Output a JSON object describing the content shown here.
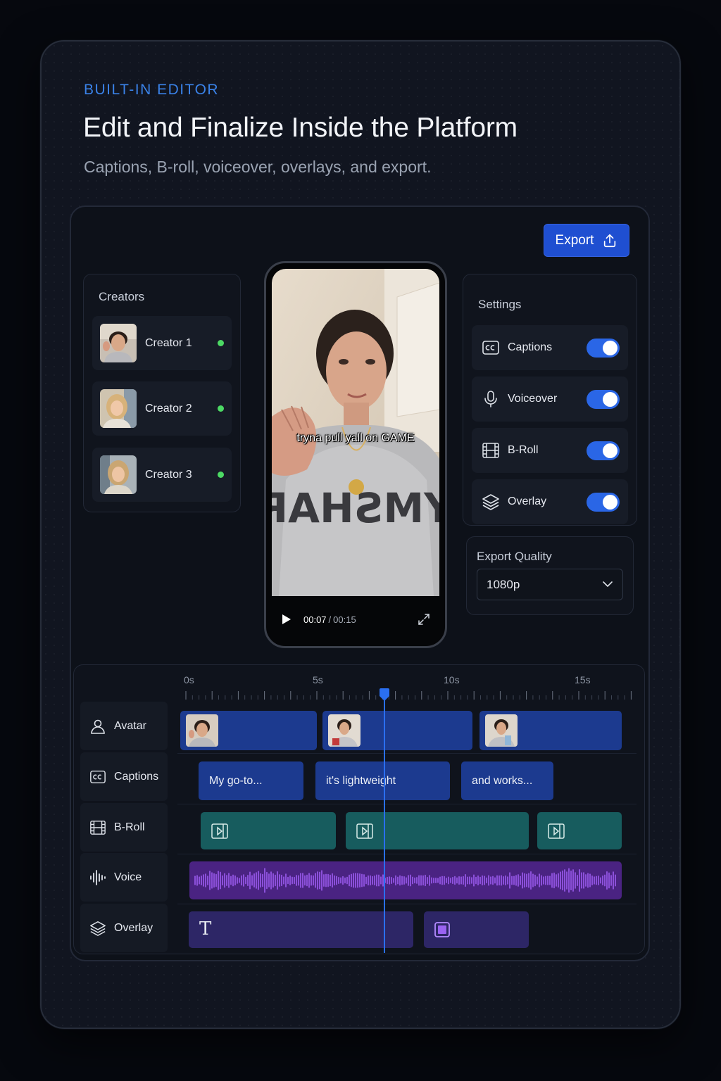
{
  "header": {
    "eyebrow": "BUILT-IN EDITOR",
    "title": "Edit and Finalize Inside the Platform",
    "subtitle": "Captions, B-roll, voiceover, overlays, and export."
  },
  "toolbar": {
    "export_label": "Export"
  },
  "creators": {
    "title": "Creators",
    "items": [
      {
        "name": "Creator 1",
        "status": "online"
      },
      {
        "name": "Creator 2",
        "status": "online"
      },
      {
        "name": "Creator 3",
        "status": "online"
      }
    ]
  },
  "preview": {
    "caption": "tryna pull yall on GAME",
    "current_time": "00:07",
    "separator": "/",
    "total_time": "00:15",
    "sweatshirt_text": "GYMSHARK"
  },
  "settings": {
    "title": "Settings",
    "items": [
      {
        "label": "Captions",
        "icon": "cc-icon",
        "enabled": true
      },
      {
        "label": "Voiceover",
        "icon": "microphone-icon",
        "enabled": true
      },
      {
        "label": "B-Roll",
        "icon": "film-icon",
        "enabled": true
      },
      {
        "label": "Overlay",
        "icon": "layers-icon",
        "enabled": true
      }
    ],
    "export_quality": {
      "label": "Export Quality",
      "value": "1080p"
    }
  },
  "timeline": {
    "ticks": [
      "0s",
      "5s",
      "10s",
      "15s"
    ],
    "playhead_seconds": 7.5,
    "tracks": [
      {
        "label": "Avatar",
        "icon": "user-icon"
      },
      {
        "label": "Captions",
        "icon": "cc-icon"
      },
      {
        "label": "B-Roll",
        "icon": "film-icon"
      },
      {
        "label": "Voice",
        "icon": "waveform-icon"
      },
      {
        "label": "Overlay",
        "icon": "layers-icon"
      }
    ],
    "caption_clips": [
      "My go-to...",
      "it's lightweight",
      "and works..."
    ],
    "overlay_text_glyph": "T"
  },
  "colors": {
    "accent": "#1f4fd1",
    "eyebrow": "#3a82e8",
    "online": "#4cd964",
    "avatar_clip": "#1c3a8f",
    "broll_clip": "#175c5e",
    "voice_clip": "#4a2382",
    "overlay_clip": "#2d2666"
  }
}
